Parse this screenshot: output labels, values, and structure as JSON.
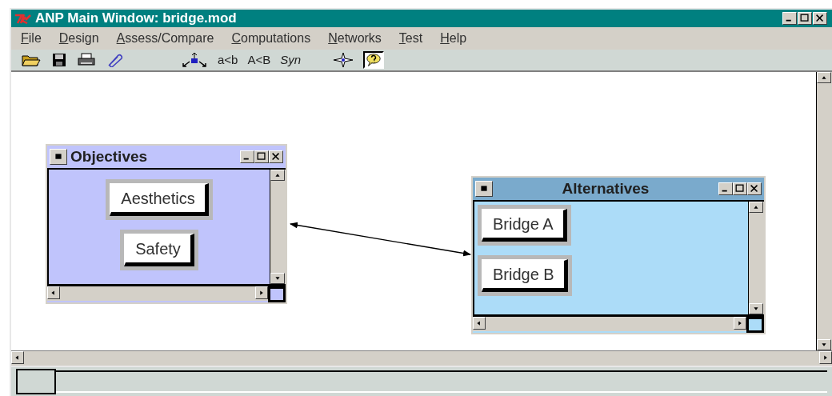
{
  "window": {
    "title": "ANP Main Window: bridge.mod"
  },
  "menu": [
    "File",
    "Design",
    "Assess/Compare",
    "Computations",
    "Networks",
    "Test",
    "Help"
  ],
  "toolbar": {
    "comparison_modes": [
      "a<b",
      "A<B",
      "Syn"
    ],
    "help_pressed": true
  },
  "clusters": [
    {
      "title": "Objectives",
      "color": "#c0c4fc",
      "nodes": [
        "Aesthetics",
        "Safety"
      ]
    },
    {
      "title": "Alternatives",
      "color": "#acdcf8",
      "nodes": [
        "Bridge A",
        "Bridge B"
      ]
    }
  ]
}
